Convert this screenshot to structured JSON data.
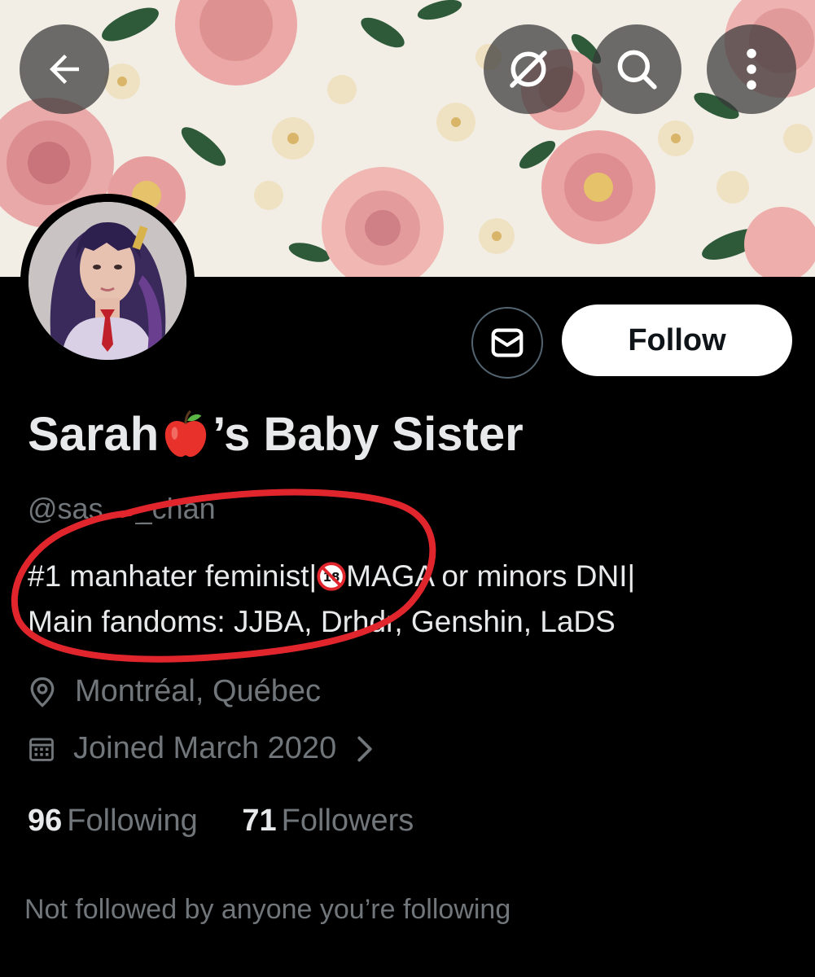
{
  "header": {
    "back_icon": "arrow-left-icon",
    "link_icon": "slashed-circle-link-icon",
    "search_icon": "search-icon",
    "more_icon": "vertical-dots-icon"
  },
  "profile": {
    "display_name_before": "Sarah",
    "display_name_emoji": "apple-emoji",
    "display_name_after": "’s Baby Sister",
    "handle": "@sasha_chan",
    "bio_line1_a": "#1 manhater feminist|",
    "bio_line1_emoji": "under-18-prohibited-emoji",
    "bio_line1_b": "MAGA or minors DNI|",
    "bio_line2": "Main fandoms: JJBA, Drhdr, Genshin, LaDS",
    "location": "Montréal, Québec",
    "joined": "Joined March 2020",
    "following_count": "96",
    "following_label": "Following",
    "followers_count": "71",
    "followers_label": "Followers",
    "followed_by_note": "Not followed by anyone you’re following"
  },
  "actions": {
    "follow_label": "Follow",
    "message_icon": "envelope-icon"
  },
  "colors": {
    "background": "#000000",
    "primary_text": "#e7e9ea",
    "secondary_text": "#71767b",
    "follow_button_bg": "#ffffff",
    "annotation_red": "#e0262c"
  }
}
